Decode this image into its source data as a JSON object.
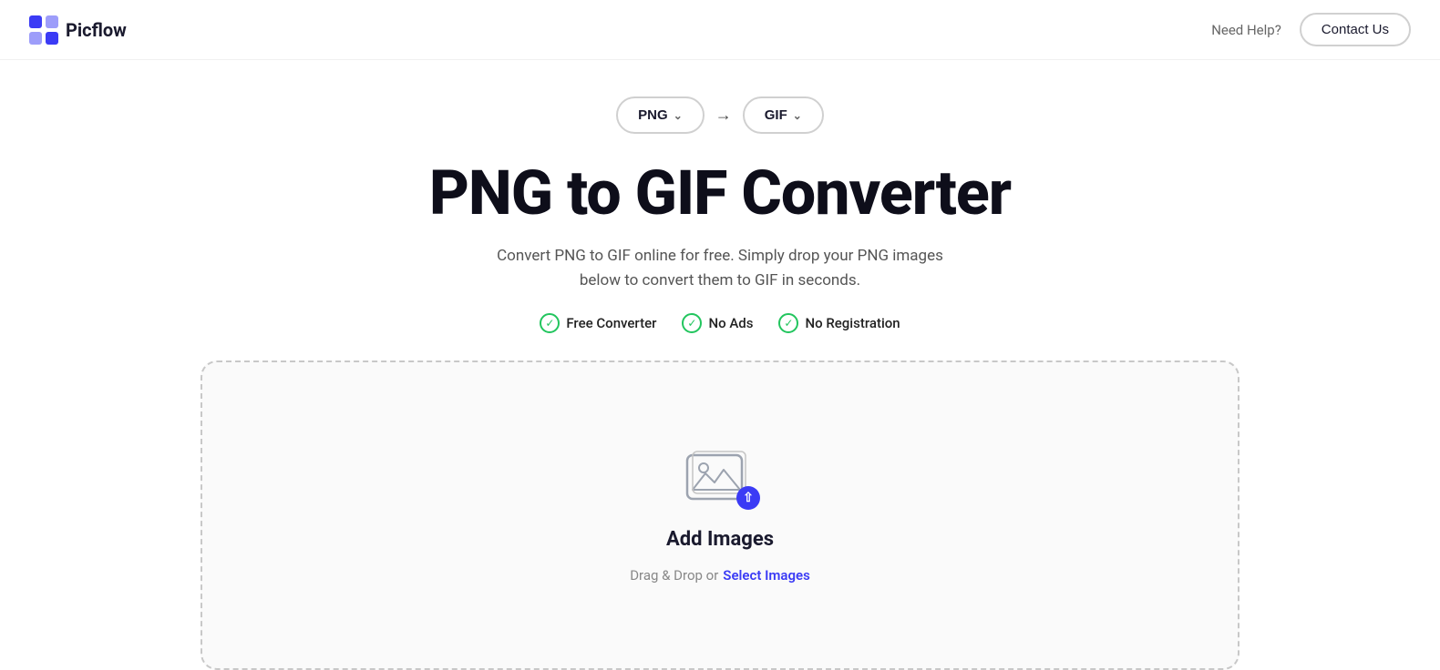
{
  "navbar": {
    "logo_text": "Picflow",
    "need_help_label": "Need Help?",
    "contact_btn_label": "Contact Us"
  },
  "format_selector": {
    "from_format": "PNG",
    "to_format": "GIF",
    "arrow": "→"
  },
  "hero": {
    "title": "PNG to GIF Converter",
    "subtitle": "Convert PNG to GIF online for free. Simply drop your PNG images below to convert them to GIF in seconds.",
    "badges": [
      {
        "label": "Free Converter"
      },
      {
        "label": "No Ads"
      },
      {
        "label": "No Registration"
      }
    ]
  },
  "dropzone": {
    "add_images_label": "Add Images",
    "drag_drop_text": "Drag & Drop or",
    "select_link_text": "Select Images"
  },
  "colors": {
    "accent_blue": "#3b3bf5",
    "check_green": "#22c55e",
    "border_gray": "#c8c8c8"
  }
}
